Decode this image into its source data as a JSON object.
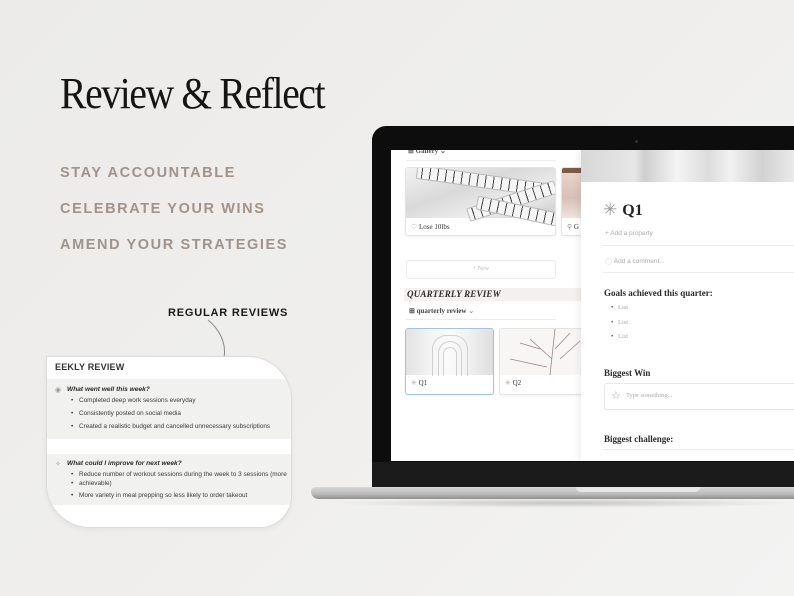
{
  "hero": {
    "title": "Review & Reflect",
    "taglines": [
      "STAY ACCOUNTABLE",
      "CELEBRATE YOUR WINS",
      "AMEND YOUR STRATEGIES"
    ],
    "callout": "REGULAR REVIEWS"
  },
  "weekly_review": {
    "title": "EEKLY REVIEW",
    "sections": [
      {
        "icon": "sun-icon",
        "question": "What went well this week?",
        "items": [
          "Completed deep work sessions everyday",
          "Consistently posted on social media",
          "Created a realistic budget and cancelled unnecessary subscriptions"
        ]
      },
      {
        "icon": "sparkle-icon",
        "question": "What could I improve for next week?",
        "items": [
          "Reduce number of workout sessions during the week to 3 sessions (more",
          "achievable)",
          "More variety in meal prepping so less likely to order takeout"
        ]
      }
    ]
  },
  "app": {
    "gallery_view_label": "Gallery",
    "goal_cards": [
      {
        "icon": "heart-icon",
        "label": "Lose 10lbs"
      },
      {
        "icon": "person-icon",
        "label": "G"
      }
    ],
    "new_button": "+ New",
    "quarterly_heading": "QUARTERLY REVIEW",
    "quarterly_view_label": "quarterly review",
    "quarter_cards": [
      {
        "icon": "asterisk-icon",
        "label": "Q1"
      },
      {
        "icon": "asterisk-icon",
        "label": "Q2"
      }
    ]
  },
  "page": {
    "icon": "asterisk-icon",
    "title": "Q1",
    "add_property": "Add a property",
    "add_comment": "Add a comment...",
    "goals_heading": "Goals achieved this quarter:",
    "goals": [
      "List",
      "List",
      "List"
    ],
    "win_heading": "Biggest Win",
    "win_placeholder": "Type something...",
    "challenge_heading": "Biggest challenge:"
  }
}
